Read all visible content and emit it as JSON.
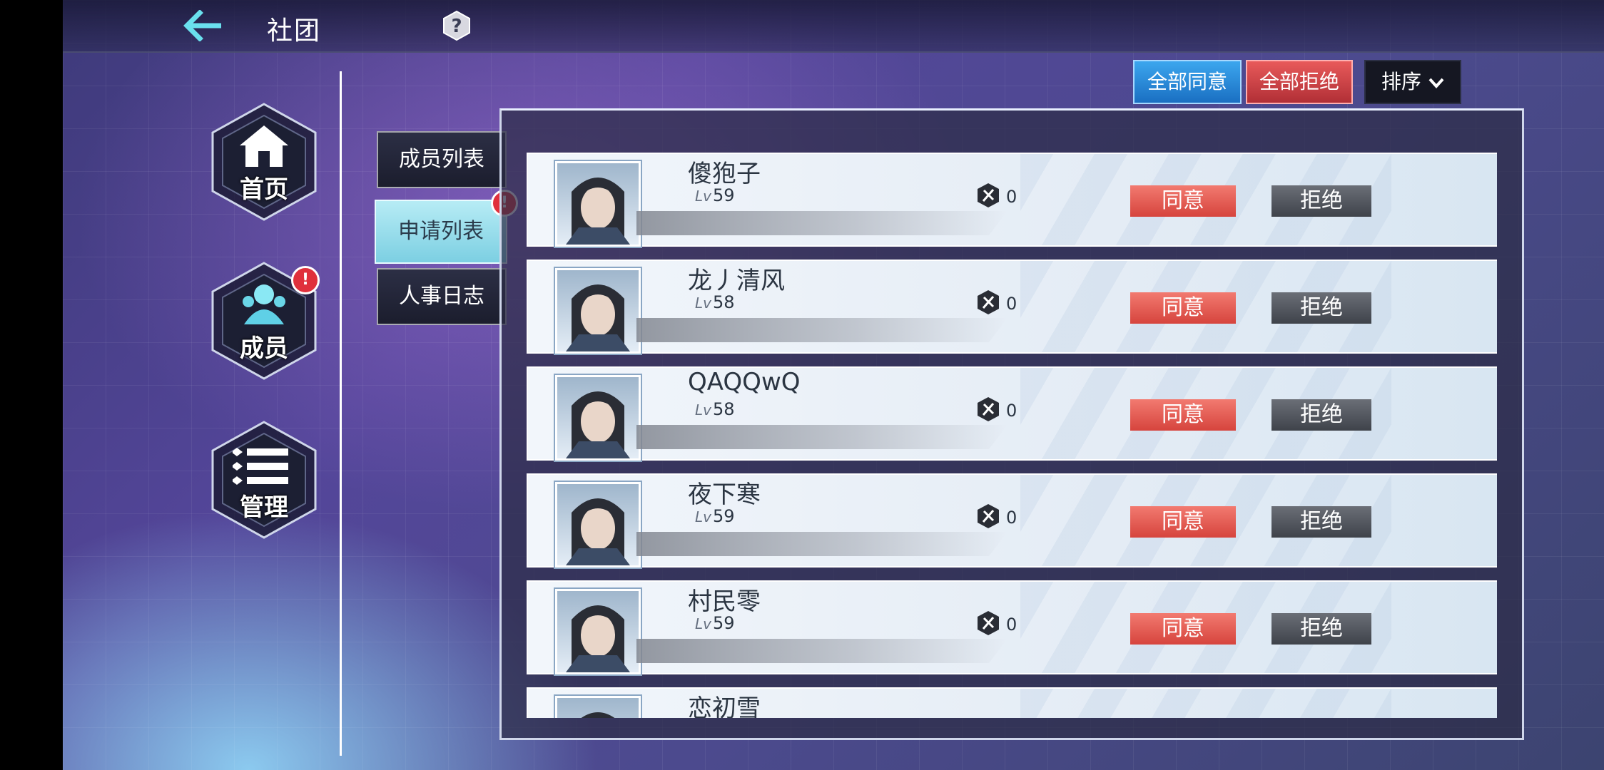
{
  "header": {
    "title": "社团",
    "back_icon": "back-arrow-icon",
    "help_icon": "help-icon"
  },
  "sidebar": {
    "items": [
      {
        "label": "首页",
        "icon": "home-icon",
        "badge": ""
      },
      {
        "label": "成员",
        "icon": "members-icon",
        "badge": "!"
      },
      {
        "label": "管理",
        "icon": "list-icon",
        "badge": ""
      }
    ]
  },
  "subtabs": [
    {
      "label": "成员列表",
      "active": false
    },
    {
      "label": "申请列表",
      "active": true,
      "badge": "!"
    },
    {
      "label": "人事日志",
      "active": false
    }
  ],
  "actions": {
    "accept_all": "全部同意",
    "reject_all": "全部拒绝",
    "sort": "排序"
  },
  "applications": [
    {
      "name": "傻狍子",
      "level_prefix": "Lv",
      "level": "59",
      "stat": "0",
      "agree": "同意",
      "decline": "拒绝"
    },
    {
      "name": "龙丿清风",
      "level_prefix": "Lv",
      "level": "58",
      "stat": "0",
      "agree": "同意",
      "decline": "拒绝"
    },
    {
      "name": "QAQQwQ",
      "level_prefix": "Lv",
      "level": "58",
      "stat": "0",
      "agree": "同意",
      "decline": "拒绝"
    },
    {
      "name": "夜下寒",
      "level_prefix": "Lv",
      "level": "59",
      "stat": "0",
      "agree": "同意",
      "decline": "拒绝"
    },
    {
      "name": "村民零",
      "level_prefix": "Lv",
      "level": "59",
      "stat": "0",
      "agree": "同意",
      "decline": "拒绝"
    },
    {
      "name": "恋初雪",
      "level_prefix": "Lv",
      "level": "",
      "stat": "",
      "agree": "",
      "decline": ""
    }
  ],
  "colors": {
    "accent": "#6ae0ee",
    "agree": "#e0514a",
    "decline": "#4a4e56",
    "accept_all": "#2a8ad8",
    "reject_all": "#c8404a"
  }
}
